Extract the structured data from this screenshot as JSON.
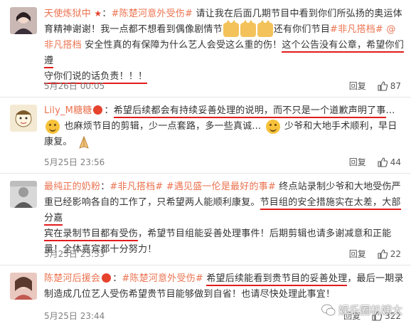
{
  "comments": [
    {
      "username": "天使炼狱中",
      "tag": "#陈楚河意外受伤#",
      "text_parts": {
        "a": "请让我在后面几期节目中看到你们所弘扬的奥运体育精神谢谢！我一点都不想看到偶像剧情节",
        "b": "还有你们节目",
        "tag2": "#非凡搭档#",
        "mention": "@非凡搭档",
        "c": "安全性真的有保障为什么艺人会受这么重的伤！",
        "ul1": "这个公告没有公章，希望你们遵",
        "ul2": "守你们说的话负责！！！"
      },
      "time": "5月26日 00:05",
      "reply": "回复",
      "likes": "87"
    },
    {
      "username": "Lily_M糖糖",
      "text_parts": {
        "ul": "希望后续都会有持续妥善处理的说明，而不只是一个道歉声明了事",
        "a": "...",
        "b": "也麻烦节目的剪辑，少一点套路，多一些真诚...",
        "c": "少爷和大地手术顺利，早日康复。"
      },
      "time": "5月25日 23:56",
      "reply": "回复",
      "likes": "44"
    },
    {
      "username": "最纯正的奶粉",
      "text_parts": {
        "tag1": "#非凡搭档#",
        "tag2": "#遇见盛一伦是最好的事#",
        "a": "终点站录制少爷和大地受伤严重已经影响各自的工作了，只希望两人能顺利康复。",
        "ul1": "节目组的安全措施实在太差，大部分嘉",
        "ul2": "宾在录制节目都有受伤",
        "b": "，希望节目组能妥善处理事件！后期剪辑也请多谢减意和正能量！全体嘉宾都十分努力！"
      },
      "time": "5月25日 23:53",
      "reply": "回复",
      "likes": "22"
    },
    {
      "username": "陈楚河后援会",
      "tag": "#陈楚河意外受伤#",
      "text_parts": {
        "ul": "希望后续能看到贵节目的妥善处理",
        "a": "，最后一期录制造成几位艺人受伤希望贵节目能够做到自省！也请尽快处理此事宜！"
      },
      "time": "5月25日 23:44",
      "reply": "回复",
      "likes": "322"
    }
  ],
  "watermark": "娱乐圈机姨太",
  "colors": {
    "accent": "#eb7350",
    "underline": "#e21d1d",
    "meta": "#808080"
  }
}
